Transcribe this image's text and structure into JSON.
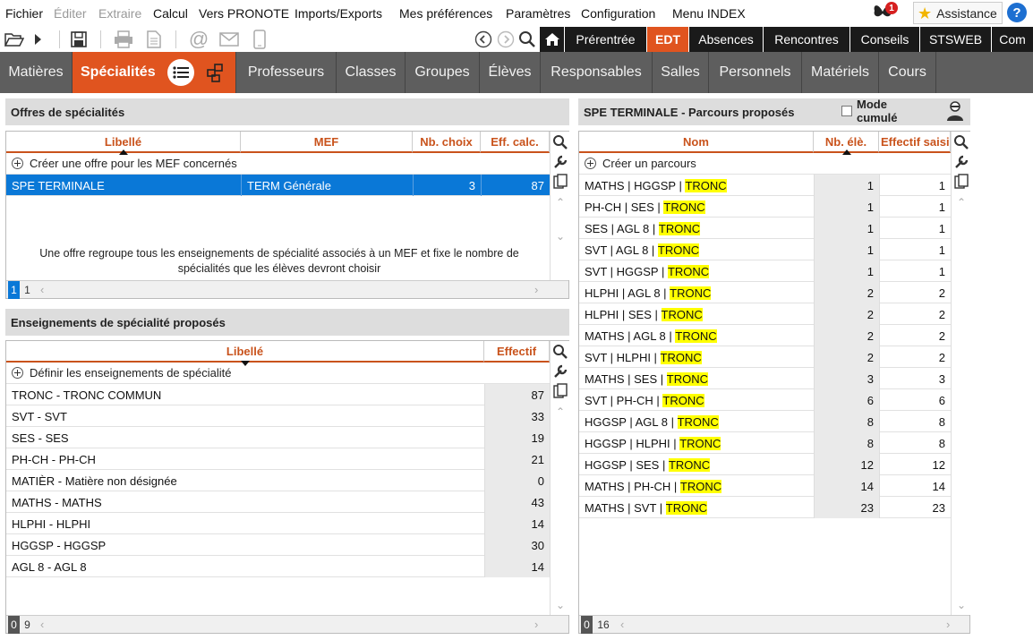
{
  "menubar": {
    "items": [
      "Fichier",
      "Éditer",
      "Extraire",
      "Calcul",
      "Vers PRONOTE",
      "Imports/Exports",
      "Mes préférences",
      "Paramètres",
      "Configuration",
      "Menu INDEX"
    ],
    "notification_count": "1",
    "assistance_label": "Assistance",
    "help_label": "?"
  },
  "top_tabs": [
    "Prérentrée",
    "EDT",
    "Absences",
    "Rencontres",
    "Conseils",
    "STSWEB",
    "Com"
  ],
  "sub_tabs": [
    "Matières",
    "Spécialités",
    "Professeurs",
    "Classes",
    "Groupes",
    "Élèves",
    "Responsables",
    "Salles",
    "Personnels",
    "Matériels",
    "Cours"
  ],
  "offres": {
    "title": "Offres de spécialités",
    "columns": [
      "Libellé",
      "MEF",
      "Nb. choix",
      "Eff. calc."
    ],
    "add_label": "Créer une offre pour les MEF concernés",
    "rows": [
      {
        "libelle": "SPE TERMINALE",
        "mef": "TERM Générale",
        "nb_choix": "3",
        "eff": "87"
      }
    ],
    "info": "Une offre regroupe tous les enseignements de spécialité associés à un MEF et fixe le nombre de spécialités que les élèves devront choisir",
    "footer_sel": "1",
    "footer_count": "1"
  },
  "enseignements": {
    "title": "Enseignements de spécialité proposés",
    "columns": [
      "Libellé",
      "Effectif"
    ],
    "add_label": "Définir les enseignements de spécialité",
    "rows": [
      {
        "libelle": "TRONC - TRONC COMMUN",
        "effectif": "87"
      },
      {
        "libelle": "SVT - SVT",
        "effectif": "33"
      },
      {
        "libelle": "SES - SES",
        "effectif": "19"
      },
      {
        "libelle": "PH-CH - PH-CH",
        "effectif": "21"
      },
      {
        "libelle": "MATIÈR - Matière non désignée",
        "effectif": "0"
      },
      {
        "libelle": "MATHS - MATHS",
        "effectif": "43"
      },
      {
        "libelle": "HLPHI - HLPHI",
        "effectif": "14"
      },
      {
        "libelle": "HGGSP - HGGSP",
        "effectif": "30"
      },
      {
        "libelle": "AGL 8 - AGL 8",
        "effectif": "14"
      }
    ],
    "footer_sel": "0",
    "footer_count": "9"
  },
  "parcours": {
    "title": "SPE TERMINALE - Parcours proposés",
    "mode_cumule_label": "Mode cumulé",
    "columns": [
      "Nom",
      "Nb. élè.",
      "Effectif saisi"
    ],
    "add_label": "Créer un parcours",
    "rows": [
      {
        "nom": "MATHS | HGGSP | ",
        "tronc": "TRONC",
        "nb": "1",
        "eff": "1"
      },
      {
        "nom": "PH-CH | SES | ",
        "tronc": "TRONC",
        "nb": "1",
        "eff": "1"
      },
      {
        "nom": "SES | AGL 8 | ",
        "tronc": "TRONC",
        "nb": "1",
        "eff": "1"
      },
      {
        "nom": "SVT | AGL 8 | ",
        "tronc": "TRONC",
        "nb": "1",
        "eff": "1"
      },
      {
        "nom": "SVT | HGGSP | ",
        "tronc": "TRONC",
        "nb": "1",
        "eff": "1"
      },
      {
        "nom": "HLPHI | AGL 8 | ",
        "tronc": "TRONC",
        "nb": "2",
        "eff": "2"
      },
      {
        "nom": "HLPHI | SES | ",
        "tronc": "TRONC",
        "nb": "2",
        "eff": "2"
      },
      {
        "nom": "MATHS | AGL 8 | ",
        "tronc": "TRONC",
        "nb": "2",
        "eff": "2"
      },
      {
        "nom": "SVT | HLPHI | ",
        "tronc": "TRONC",
        "nb": "2",
        "eff": "2"
      },
      {
        "nom": "MATHS | SES | ",
        "tronc": "TRONC",
        "nb": "3",
        "eff": "3"
      },
      {
        "nom": "SVT | PH-CH | ",
        "tronc": "TRONC",
        "nb": "6",
        "eff": "6"
      },
      {
        "nom": "HGGSP | AGL 8 | ",
        "tronc": "TRONC",
        "nb": "8",
        "eff": "8"
      },
      {
        "nom": "HGGSP | HLPHI | ",
        "tronc": "TRONC",
        "nb": "8",
        "eff": "8"
      },
      {
        "nom": "HGGSP | SES | ",
        "tronc": "TRONC",
        "nb": "12",
        "eff": "12"
      },
      {
        "nom": "MATHS | PH-CH | ",
        "tronc": "TRONC",
        "nb": "14",
        "eff": "14"
      },
      {
        "nom": "MATHS | SVT | ",
        "tronc": "TRONC",
        "nb": "23",
        "eff": "23"
      }
    ],
    "footer_sel": "0",
    "footer_count": "16"
  }
}
